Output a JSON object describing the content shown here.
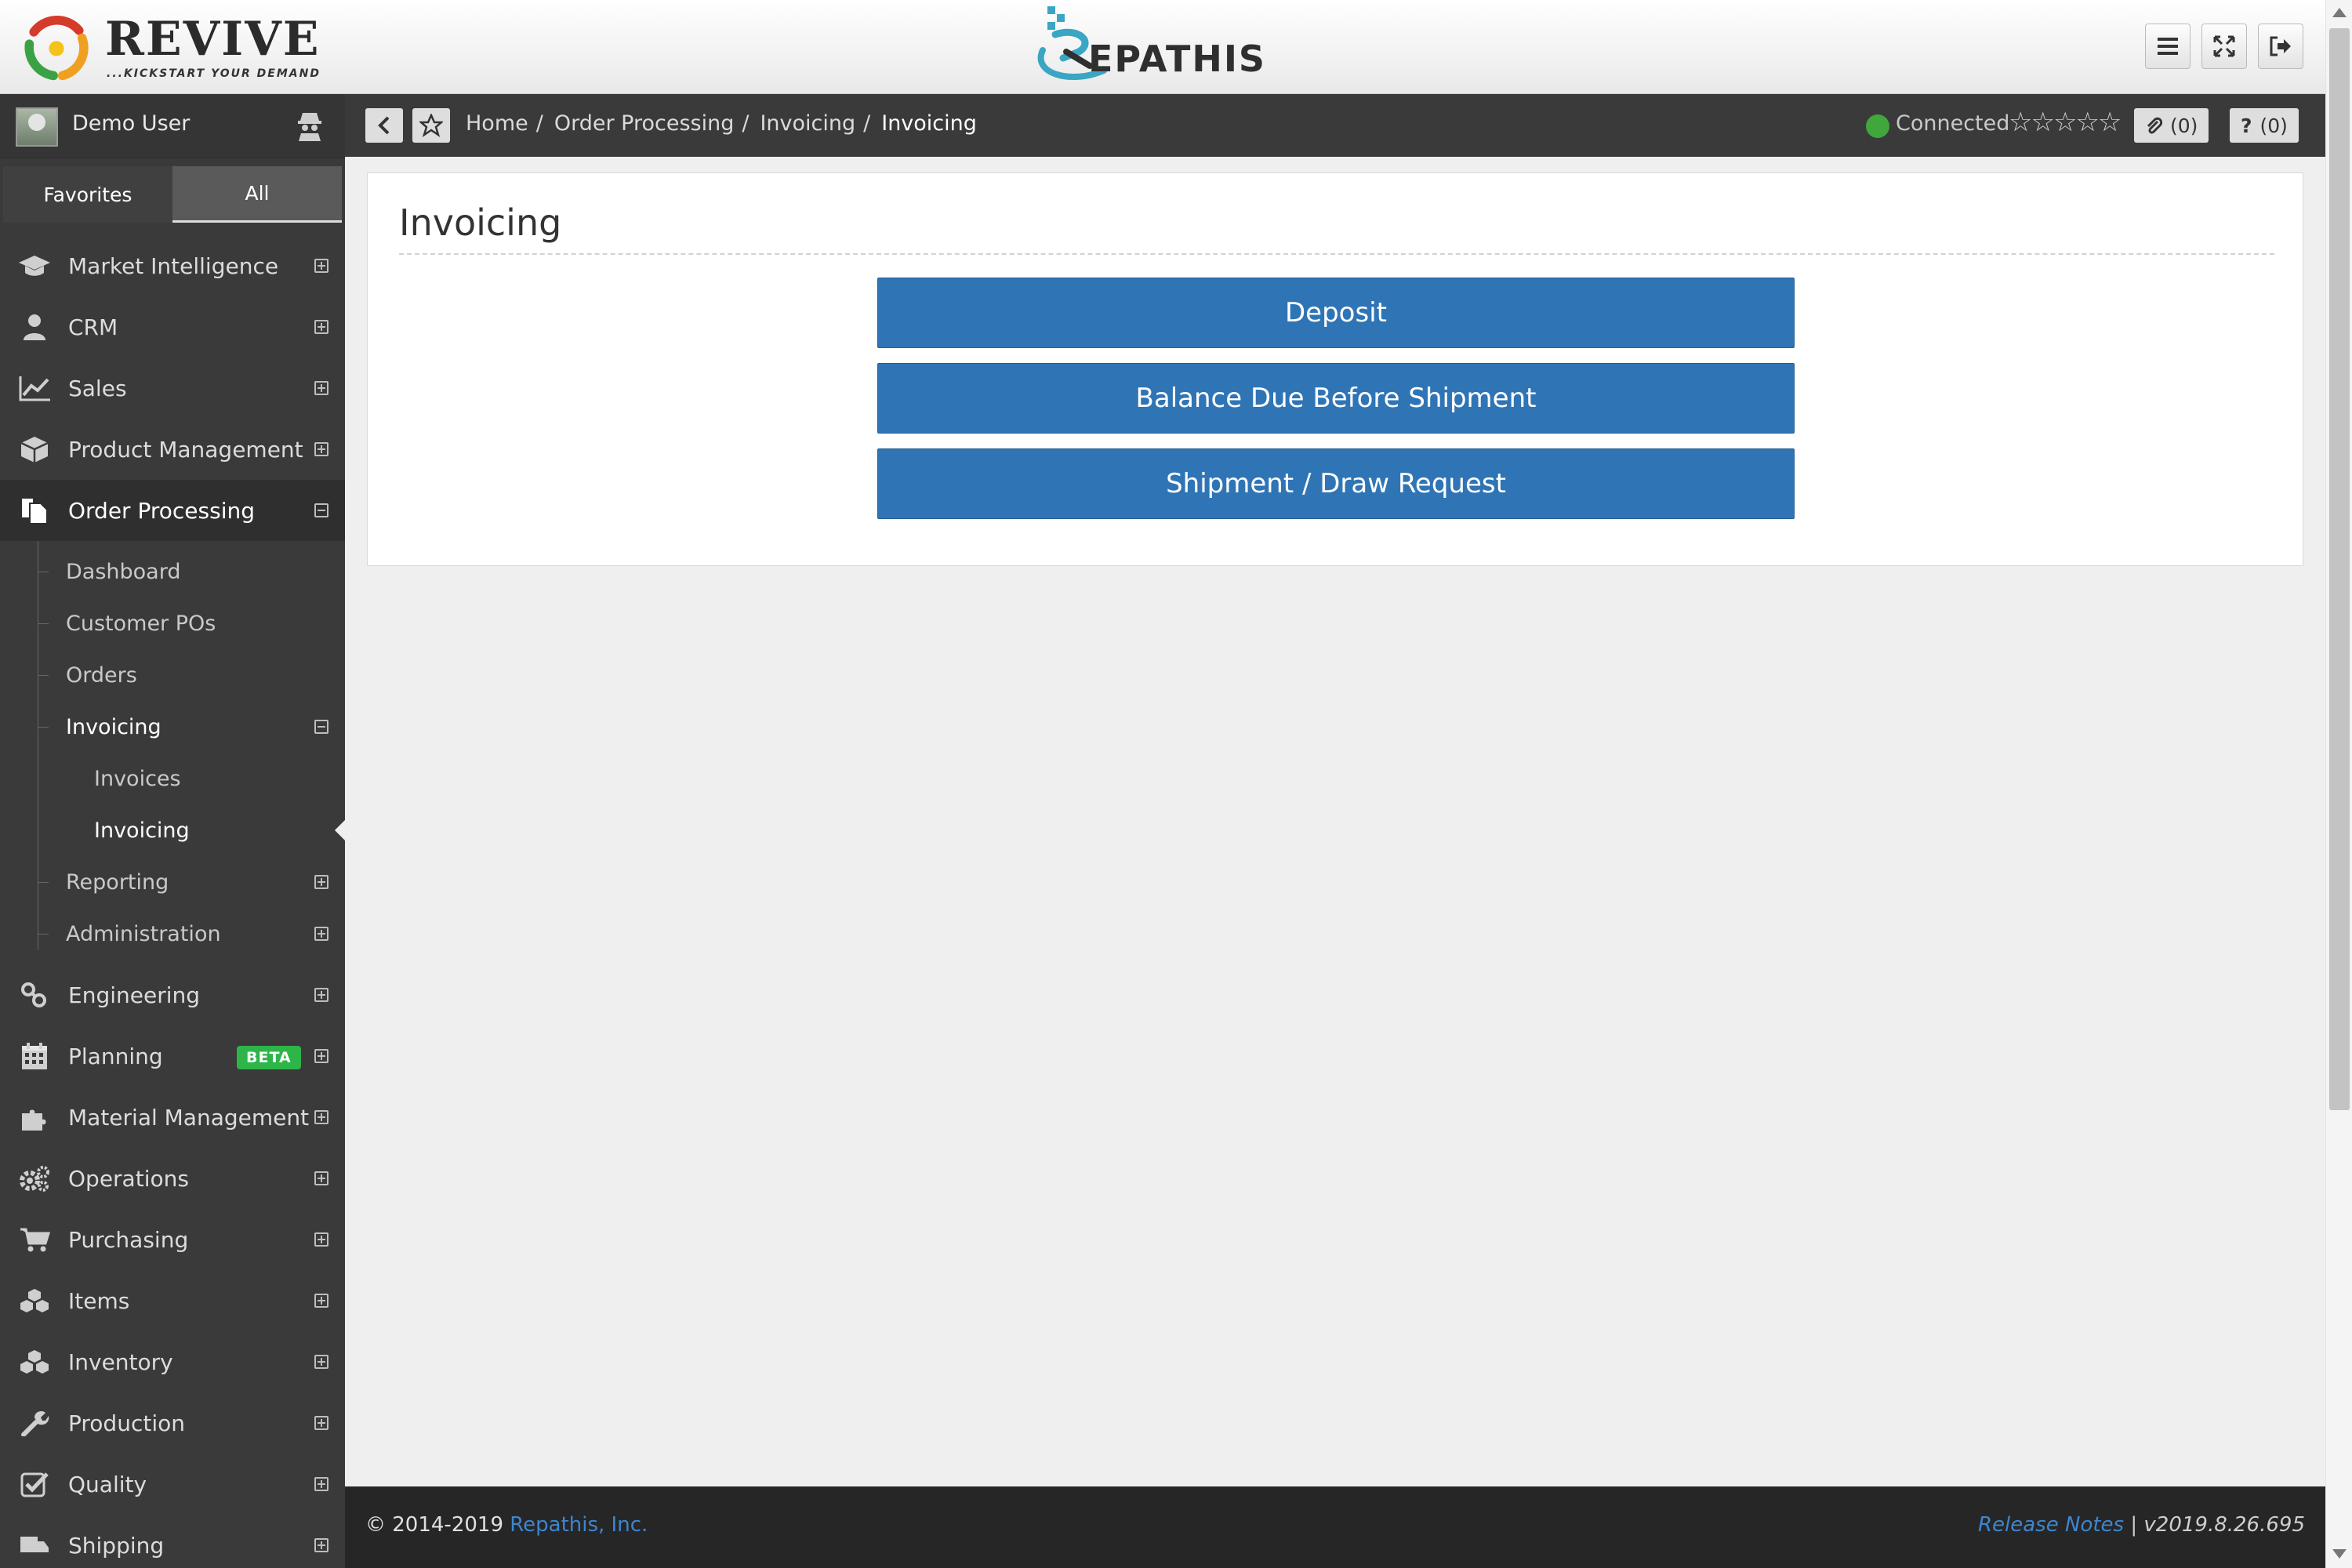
{
  "header": {
    "brand_name": "REVIVE",
    "brand_tagline": "...KICKSTART YOUR DEMAND",
    "product_name": "EPATHIS",
    "buttons": [
      "menu-icon",
      "fullscreen-icon",
      "logout-icon"
    ]
  },
  "sidebar": {
    "user_name": "Demo User",
    "tabs": {
      "favorites": "Favorites",
      "all": "All"
    },
    "items_top": [
      {
        "label": "Market Intelligence",
        "icon": "graduation-cap-icon"
      },
      {
        "label": "CRM",
        "icon": "user-icon"
      },
      {
        "label": "Sales",
        "icon": "line-chart-icon"
      },
      {
        "label": "Product Management",
        "icon": "cube-icon"
      },
      {
        "label": "Order Processing",
        "icon": "files-icon"
      }
    ],
    "order_processing_children": [
      {
        "label": "Dashboard"
      },
      {
        "label": "Customer POs"
      },
      {
        "label": "Orders"
      },
      {
        "label": "Invoicing"
      }
    ],
    "invoicing_children": [
      {
        "label": "Invoices"
      },
      {
        "label": "Invoicing"
      }
    ],
    "order_processing_children_after": [
      {
        "label": "Reporting"
      },
      {
        "label": "Administration"
      }
    ],
    "items_bottom": [
      {
        "label": "Engineering",
        "icon": "link-icon"
      },
      {
        "label": "Planning",
        "icon": "calendar-icon",
        "badge": "BETA"
      },
      {
        "label": "Material Management",
        "icon": "puzzle-icon"
      },
      {
        "label": "Operations",
        "icon": "gears-icon"
      },
      {
        "label": "Purchasing",
        "icon": "cart-icon"
      },
      {
        "label": "Items",
        "icon": "cubes-icon"
      },
      {
        "label": "Inventory",
        "icon": "cubes-icon"
      },
      {
        "label": "Production",
        "icon": "wrench-icon"
      },
      {
        "label": "Quality",
        "icon": "check-square-icon"
      },
      {
        "label": "Shipping",
        "icon": "truck-icon"
      }
    ]
  },
  "breadcrumb": {
    "items": [
      "Home",
      "Order Processing",
      "Invoicing"
    ],
    "current": "Invoicing",
    "status": "Connected",
    "attachments_count": "(0)",
    "help_count": "(0)"
  },
  "main": {
    "title": "Invoicing",
    "actions": [
      "Deposit",
      "Balance Due Before Shipment",
      "Shipment / Draw Request"
    ]
  },
  "footer": {
    "copyright": "© 2014-2019",
    "company": "Repathis, Inc.",
    "release_notes": "Release Notes",
    "separator": "|",
    "version": "v2019.8.26.695"
  },
  "colors": {
    "accent": "#2f75b5",
    "sidebar_bg": "#3a3a3a",
    "status_connected": "#3fa73b",
    "beta_badge": "#2db548"
  }
}
